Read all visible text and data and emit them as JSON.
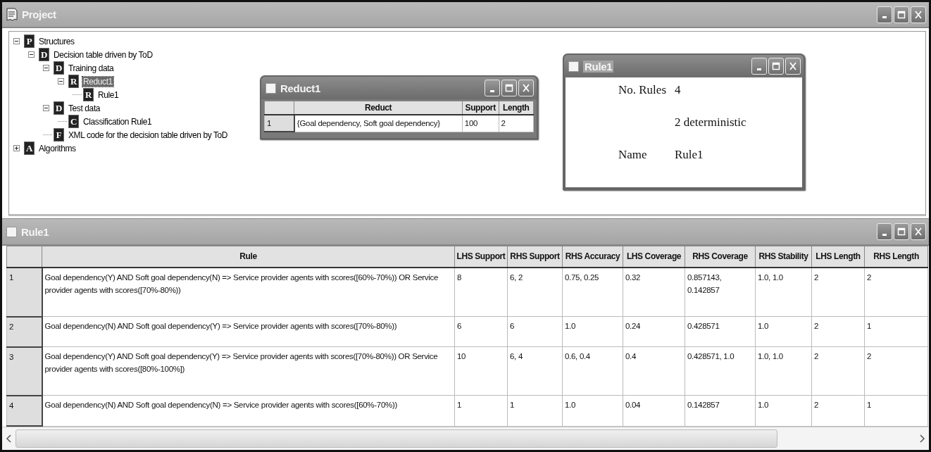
{
  "project_window": {
    "title": "Project",
    "tree": [
      {
        "badge": "P",
        "label": "Structures",
        "expanded": true,
        "selected": false,
        "children": [
          {
            "badge": "D",
            "label": "Decision table driven by ToD",
            "expanded": true,
            "selected": false,
            "children": [
              {
                "badge": "D",
                "label": "Training data",
                "expanded": true,
                "selected": false,
                "children": [
                  {
                    "badge": "R",
                    "label": "Reduct1",
                    "expanded": true,
                    "selected": true,
                    "children": [
                      {
                        "badge": "R",
                        "label": "Rule1",
                        "selected": false
                      }
                    ]
                  }
                ]
              },
              {
                "badge": "D",
                "label": "Test data",
                "expanded": true,
                "selected": false,
                "children": [
                  {
                    "badge": "C",
                    "label": "Classification Rule1",
                    "selected": false
                  }
                ]
              },
              {
                "badge": "F",
                "label": "XML code for the decision table driven by ToD",
                "selected": false
              }
            ]
          }
        ]
      },
      {
        "badge": "A",
        "label": "Algorithms",
        "expanded": false,
        "selected": false
      }
    ]
  },
  "reduct_window": {
    "title": "Reduct1",
    "table": {
      "columns": [
        "Reduct",
        "Support",
        "Length"
      ],
      "rows": [
        {
          "index": "1",
          "cells": [
            "{Goal dependency, Soft goal dependency}",
            "100",
            "2"
          ]
        }
      ]
    }
  },
  "rule_summary_window": {
    "title": "Rule1",
    "lines": [
      {
        "kind": "pair",
        "label": "No. Rules",
        "value": "4"
      },
      {
        "kind": "indent",
        "value": "2 deterministic"
      },
      {
        "kind": "pair",
        "label": "Name",
        "value": "Rule1"
      }
    ]
  },
  "rules_window": {
    "title": "Rule1",
    "table": {
      "columns": [
        "Rule",
        "LHS Support",
        "RHS Support",
        "RHS Accuracy",
        "LHS Coverage",
        "RHS Coverage",
        "RHS Stability",
        "LHS Length",
        "RHS Length"
      ],
      "rows": [
        {
          "index": "1",
          "cells": [
            "Goal dependency(Y) AND Soft goal dependency(N) => Service provider agents with scores([60%-70%)) OR Service provider agents with scores([70%-80%))",
            "8",
            "6, 2",
            "0.75, 0.25",
            "0.32",
            "0.857143, 0.142857",
            "1.0, 1.0",
            "2",
            "2"
          ]
        },
        {
          "index": "2",
          "cells": [
            "Goal dependency(N) AND Soft goal dependency(Y) => Service provider agents with scores([70%-80%))",
            "6",
            "6",
            "1.0",
            "0.24",
            "0.428571",
            "1.0",
            "2",
            "1"
          ]
        },
        {
          "index": "3",
          "cells": [
            "Goal dependency(Y) AND Soft goal dependency(Y) => Service provider agents with scores([70%-80%)) OR Service provider agents with scores([80%-100%])",
            "10",
            "6, 4",
            "0.6, 0.4",
            "0.4",
            "0.428571, 1.0",
            "1.0, 1.0",
            "2",
            "2"
          ]
        },
        {
          "index": "4",
          "cells": [
            "Goal dependency(N) AND Soft goal dependency(N) => Service provider agents with scores([60%-70%))",
            "1",
            "1",
            "1.0",
            "0.04",
            "0.142857",
            "1.0",
            "2",
            "1"
          ]
        }
      ]
    }
  }
}
